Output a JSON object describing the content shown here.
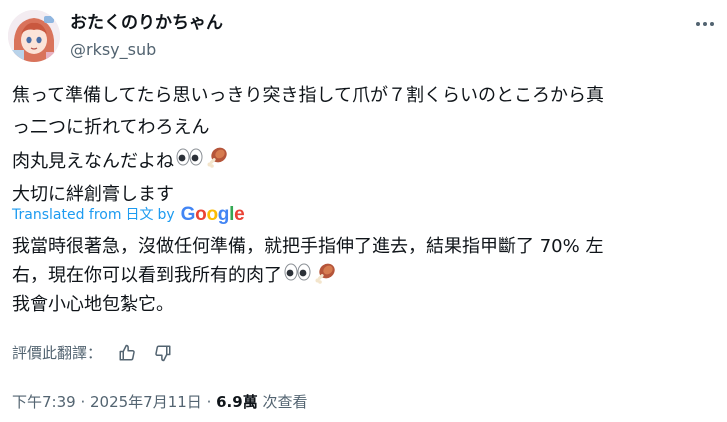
{
  "author": {
    "display_name": "おたくのりかちゃん",
    "handle": "@rksy_sub"
  },
  "more_icon": "more-horizontal-icon",
  "original_text": {
    "line1": "焦って準備してたら思いっきり突き指して爪が７割くらいのところから真",
    "line2": "っ二つに折れてわろえん",
    "line3": "肉丸見えなんだよね",
    "line4": "大切に絆創膏します",
    "emojis": [
      "eyes-emoji",
      "meat-on-bone-emoji"
    ]
  },
  "translation_note": {
    "prefix": "Translated from",
    "language": "日文",
    "by": "by",
    "provider": "Google"
  },
  "translation": {
    "line1": "我當時很著急，沒做任何準備，就把手指伸了進去，結果指甲斷了 70% 左",
    "line2": "右，現在你可以看到我所有的肉了",
    "line3": "我會小心地包紮它。"
  },
  "rating": {
    "label": "評價此翻譯：",
    "icons": [
      "thumbs-up-icon",
      "thumbs-down-icon"
    ]
  },
  "meta": {
    "time": "下午7:39",
    "sep1": " · ",
    "date": "2025年7月11日",
    "sep2": " · ",
    "views_count": "6.9萬",
    "views_label": " 次查看"
  },
  "colors": {
    "link": "#1d9bf0",
    "secondary": "#536471",
    "primary": "#0f1419"
  }
}
